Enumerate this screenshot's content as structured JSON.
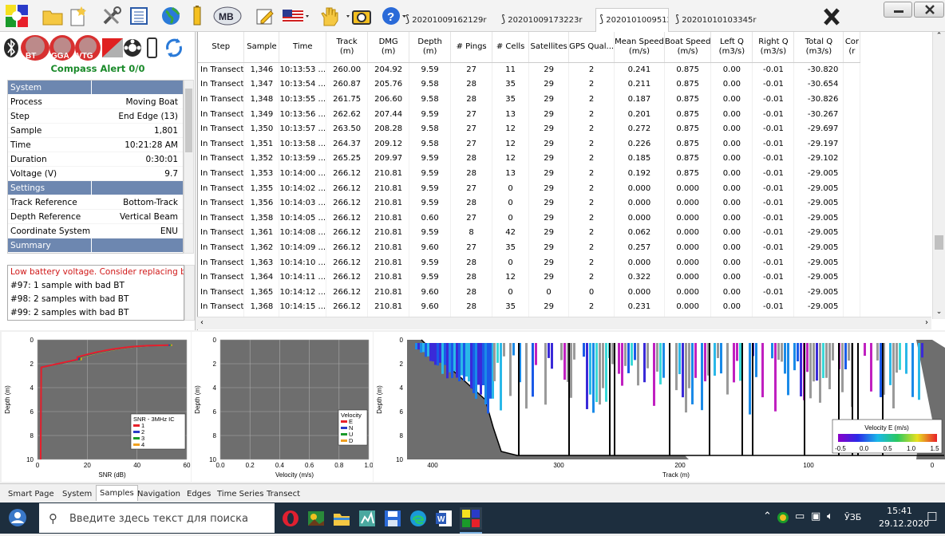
{
  "file_tabs": [
    "20201009162129r",
    "20201009173223r",
    "20201010095127r",
    "20201010103345r"
  ],
  "status": {
    "bt_label": "BT",
    "gga_label": "GGA",
    "vtg_label": "VTG",
    "compass_alert": "Compass Alert 0/0"
  },
  "properties": [
    {
      "cat": "System"
    },
    {
      "k": "Process",
      "v": "Moving Boat"
    },
    {
      "k": "Step",
      "v": "End Edge (13)"
    },
    {
      "k": "Sample",
      "v": "1,801"
    },
    {
      "k": "Time",
      "v": "10:21:28 AM"
    },
    {
      "k": "Duration",
      "v": "0:30:01"
    },
    {
      "k": "Voltage (V)",
      "v": "9.7"
    },
    {
      "cat": "Settings"
    },
    {
      "k": "Track Reference",
      "v": "Bottom-Track"
    },
    {
      "k": "Depth Reference",
      "v": "Vertical Beam"
    },
    {
      "k": "Coordinate System",
      "v": "ENU"
    },
    {
      "cat": "Summary"
    }
  ],
  "messages": [
    "Low battery voltage. Consider replacing bat",
    "#97: 1 sample with bad BT",
    "#98: 2 samples with bad BT",
    "#99: 2 samples with bad BT"
  ],
  "columns": [
    "Step",
    "Sample",
    "Time",
    "Track\n(m)",
    "DMG\n(m)",
    "Depth\n(m)",
    "# Pings",
    "# Cells",
    "Satellites",
    "GPS Qual...",
    "Mean Speed\n(m/s)",
    "Boat Speed\n(m/s)",
    "Left Q\n(m3/s)",
    "Right Q\n(m3/s)",
    "Total Q\n(m3/s)",
    "Cor\n(r"
  ],
  "rows": [
    [
      "In Transect",
      "1,346",
      "10:13:53 ...",
      "260.00",
      "204.92",
      "9.59",
      "27",
      "11",
      "29",
      "2",
      "0.241",
      "0.875",
      "0.00",
      "-0.01",
      "-30.820",
      ""
    ],
    [
      "In Transect",
      "1,347",
      "10:13:54 ...",
      "260.87",
      "205.76",
      "9.58",
      "28",
      "35",
      "29",
      "2",
      "0.211",
      "0.875",
      "0.00",
      "-0.01",
      "-30.654",
      ""
    ],
    [
      "In Transect",
      "1,348",
      "10:13:55 ...",
      "261.75",
      "206.60",
      "9.58",
      "28",
      "35",
      "29",
      "2",
      "0.187",
      "0.875",
      "0.00",
      "-0.01",
      "-30.826",
      ""
    ],
    [
      "In Transect",
      "1,349",
      "10:13:56 ...",
      "262.62",
      "207.44",
      "9.59",
      "27",
      "13",
      "29",
      "2",
      "0.201",
      "0.875",
      "0.00",
      "-0.01",
      "-30.267",
      ""
    ],
    [
      "In Transect",
      "1,350",
      "10:13:57 ...",
      "263.50",
      "208.28",
      "9.58",
      "27",
      "12",
      "29",
      "2",
      "0.272",
      "0.875",
      "0.00",
      "-0.01",
      "-29.697",
      ""
    ],
    [
      "In Transect",
      "1,351",
      "10:13:58 ...",
      "264.37",
      "209.12",
      "9.58",
      "27",
      "12",
      "29",
      "2",
      "0.226",
      "0.875",
      "0.00",
      "-0.01",
      "-29.197",
      ""
    ],
    [
      "In Transect",
      "1,352",
      "10:13:59 ...",
      "265.25",
      "209.97",
      "9.59",
      "28",
      "12",
      "29",
      "2",
      "0.185",
      "0.875",
      "0.00",
      "-0.01",
      "-29.102",
      ""
    ],
    [
      "In Transect",
      "1,353",
      "10:14:00 ...",
      "266.12",
      "210.81",
      "9.59",
      "28",
      "13",
      "29",
      "2",
      "0.192",
      "0.875",
      "0.00",
      "-0.01",
      "-29.005",
      ""
    ],
    [
      "In Transect",
      "1,355",
      "10:14:02 ...",
      "266.12",
      "210.81",
      "9.59",
      "27",
      "0",
      "29",
      "2",
      "0.000",
      "0.000",
      "0.00",
      "-0.01",
      "-29.005",
      ""
    ],
    [
      "In Transect",
      "1,356",
      "10:14:03 ...",
      "266.12",
      "210.81",
      "9.59",
      "28",
      "0",
      "29",
      "2",
      "0.000",
      "0.000",
      "0.00",
      "-0.01",
      "-29.005",
      ""
    ],
    [
      "In Transect",
      "1,358",
      "10:14:05 ...",
      "266.12",
      "210.81",
      "0.60",
      "27",
      "0",
      "29",
      "2",
      "0.000",
      "0.000",
      "0.00",
      "-0.01",
      "-29.005",
      ""
    ],
    [
      "In Transect",
      "1,361",
      "10:14:08 ...",
      "266.12",
      "210.81",
      "9.59",
      "8",
      "42",
      "29",
      "2",
      "0.062",
      "0.000",
      "0.00",
      "-0.01",
      "-29.005",
      ""
    ],
    [
      "In Transect",
      "1,362",
      "10:14:09 ...",
      "266.12",
      "210.81",
      "9.60",
      "27",
      "35",
      "29",
      "2",
      "0.257",
      "0.000",
      "0.00",
      "-0.01",
      "-29.005",
      ""
    ],
    [
      "In Transect",
      "1,363",
      "10:14:10 ...",
      "266.12",
      "210.81",
      "9.59",
      "28",
      "0",
      "29",
      "2",
      "0.000",
      "0.000",
      "0.00",
      "-0.01",
      "-29.005",
      ""
    ],
    [
      "In Transect",
      "1,364",
      "10:14:11 ...",
      "266.12",
      "210.81",
      "9.59",
      "28",
      "12",
      "29",
      "2",
      "0.322",
      "0.000",
      "0.00",
      "-0.01",
      "-29.005",
      ""
    ],
    [
      "In Transect",
      "1,365",
      "10:14:12 ...",
      "266.12",
      "210.81",
      "9.60",
      "28",
      "0",
      "0",
      "0",
      "0.000",
      "0.000",
      "0.00",
      "-0.01",
      "-29.005",
      ""
    ],
    [
      "In Transect",
      "1,368",
      "10:14:15 ...",
      "266.12",
      "210.81",
      "9.60",
      "28",
      "35",
      "29",
      "2",
      "0.231",
      "0.000",
      "0.00",
      "-0.01",
      "-29.005",
      ""
    ],
    [
      "In Transect",
      "1,369",
      "10:14:16 ...",
      "266.12",
      "210.81",
      "9.60",
      "28",
      "35",
      "29",
      "2",
      "0.254",
      "0.000",
      "0.00",
      "-0.01",
      "-29.005",
      ""
    ]
  ],
  "snr_plot": {
    "xlabel": "SNR (dB)",
    "ylabel": "Depth (m)",
    "xticks": [
      "0",
      "20",
      "40",
      "60"
    ],
    "yticks": [
      "0",
      "2",
      "4",
      "6",
      "8",
      "10"
    ],
    "legend_title": "SNR - 3MHz IC",
    "legend": [
      {
        "name": "1",
        "color": "#e8202a"
      },
      {
        "name": "2",
        "color": "#2a3ac8"
      },
      {
        "name": "3",
        "color": "#1a9a2a"
      },
      {
        "name": "4",
        "color": "#f0a020"
      }
    ]
  },
  "vel_plot": {
    "xlabel": "Velocity (m/s)",
    "ylabel": "Depth (m)",
    "xticks": [
      "0.0",
      "0.2",
      "0.4",
      "0.6",
      "0.8",
      "1.0"
    ],
    "yticks": [
      "0",
      "2",
      "4",
      "6",
      "8",
      "10"
    ],
    "legend_title": "Velocity",
    "legend": [
      {
        "name": "E",
        "color": "#e8202a"
      },
      {
        "name": "N",
        "color": "#2a3ac8"
      },
      {
        "name": "U",
        "color": "#1a9a2a"
      },
      {
        "name": "D",
        "color": "#f0a020"
      }
    ]
  },
  "contour_plot": {
    "xlabel": "Track (m)",
    "ylabel": "Depth (m)",
    "xticks": [
      "400",
      "300",
      "200",
      "100",
      "0"
    ],
    "yticks": [
      "0",
      "2",
      "4",
      "6",
      "8",
      "10"
    ],
    "colorbar_title": "Velocity E (m/s)",
    "colorbar_ticks": [
      "-0.5",
      "0.0",
      "0.5",
      "1.0",
      "1.5"
    ]
  },
  "bottom_tabs": [
    "Smart Page",
    "System",
    "Samples",
    "Navigation",
    "Edges",
    "Time Series",
    "Transect"
  ],
  "active_tab": "Samples",
  "taskbar": {
    "search_placeholder": "Введите здесь текст для поиска",
    "lang": "ЎЗБ",
    "time": "15:41",
    "date": "29.12.2020"
  }
}
